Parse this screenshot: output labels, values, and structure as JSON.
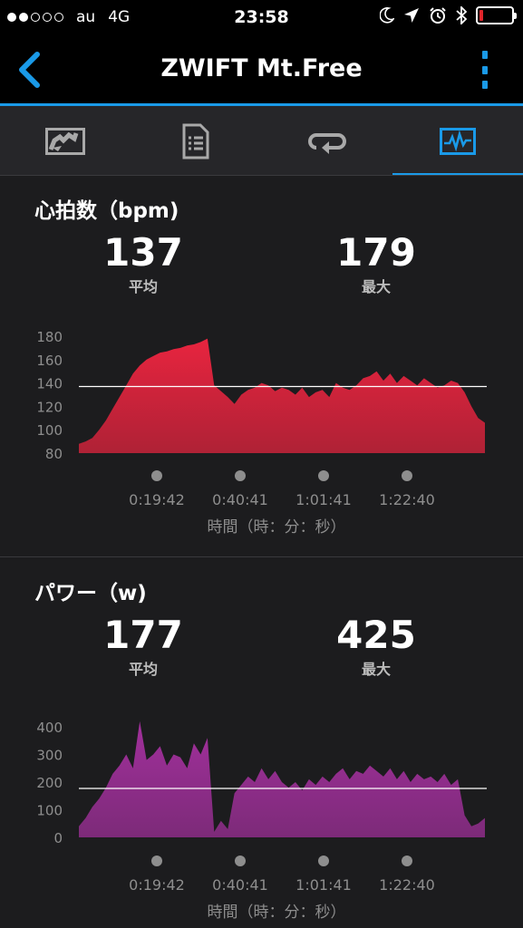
{
  "status_bar": {
    "carrier": "au",
    "network": "4G",
    "time": "23:58",
    "battery_level": 0.1,
    "icons": [
      "moon-icon",
      "location-arrow-icon",
      "alarm-clock-icon",
      "bluetooth-icon",
      "battery-icon"
    ]
  },
  "nav": {
    "title": "ZWIFT Mt.Free",
    "back_icon": "chevron-left-icon",
    "more_icon": "more-vertical-icon",
    "accent_color": "#1a9ae8"
  },
  "tabs": [
    {
      "icon": "map-icon",
      "active": false
    },
    {
      "icon": "list-document-icon",
      "active": false
    },
    {
      "icon": "laps-loop-icon",
      "active": false
    },
    {
      "icon": "chart-pulse-icon",
      "active": true
    }
  ],
  "heart_rate": {
    "title": "心拍数（bpm)",
    "avg_value": "137",
    "avg_label": "平均",
    "max_value": "179",
    "max_label": "最大",
    "fill_color": "#e8243f",
    "chart_data": {
      "type": "area",
      "ylim": [
        80,
        180
      ],
      "yticks": [
        "180",
        "160",
        "140",
        "120",
        "100",
        "80"
      ],
      "xticks": [
        "0:19:42",
        "0:40:41",
        "1:01:41",
        "1:22:40"
      ],
      "xlabel": "時間（時：分：秒）",
      "avg_line": 137,
      "x_range": [
        0,
        6000
      ],
      "x": [
        0,
        100,
        200,
        300,
        400,
        500,
        600,
        700,
        800,
        900,
        1000,
        1100,
        1200,
        1300,
        1400,
        1500,
        1600,
        1700,
        1800,
        1900,
        2000,
        2100,
        2200,
        2300,
        2400,
        2500,
        2600,
        2700,
        2800,
        2900,
        3000,
        3100,
        3200,
        3300,
        3400,
        3500,
        3600,
        3700,
        3800,
        3900,
        4000,
        4100,
        4200,
        4300,
        4400,
        4500,
        4600,
        4700,
        4800,
        4900,
        5000,
        5100,
        5200,
        5300,
        5400,
        5500,
        5600,
        5700,
        5800,
        5900,
        6000
      ],
      "values": [
        88,
        90,
        93,
        100,
        108,
        118,
        128,
        138,
        148,
        155,
        160,
        163,
        166,
        167,
        169,
        170,
        172,
        173,
        175,
        178,
        138,
        133,
        128,
        122,
        130,
        134,
        136,
        140,
        138,
        133,
        136,
        134,
        130,
        136,
        128,
        132,
        134,
        128,
        140,
        136,
        134,
        138,
        144,
        146,
        150,
        142,
        148,
        140,
        146,
        142,
        138,
        144,
        140,
        136,
        138,
        142,
        140,
        132,
        120,
        110,
        106
      ]
    }
  },
  "power": {
    "title": "パワー（w)",
    "avg_value": "177",
    "avg_label": "平均",
    "max_value": "425",
    "max_label": "最大",
    "fill_color": "#a2309c",
    "chart_data": {
      "type": "area",
      "ylim": [
        0,
        400
      ],
      "yticks": [
        "400",
        "300",
        "200",
        "100",
        "0"
      ],
      "xticks": [
        "0:19:42",
        "0:40:41",
        "1:01:41",
        "1:22:40"
      ],
      "xlabel": "時間（時：分：秒）",
      "avg_line": 177,
      "x_range": [
        0,
        6000
      ],
      "x": [
        0,
        100,
        200,
        300,
        400,
        500,
        600,
        700,
        800,
        900,
        1000,
        1100,
        1200,
        1300,
        1400,
        1500,
        1600,
        1700,
        1800,
        1900,
        2000,
        2100,
        2200,
        2300,
        2400,
        2500,
        2600,
        2700,
        2800,
        2900,
        3000,
        3100,
        3200,
        3300,
        3400,
        3500,
        3600,
        3700,
        3800,
        3900,
        4000,
        4100,
        4200,
        4300,
        4400,
        4500,
        4600,
        4700,
        4800,
        4900,
        5000,
        5100,
        5200,
        5300,
        5400,
        5500,
        5600,
        5700,
        5800,
        5900,
        6000
      ],
      "values": [
        40,
        70,
        110,
        140,
        180,
        230,
        260,
        300,
        250,
        420,
        280,
        300,
        330,
        260,
        300,
        290,
        250,
        340,
        300,
        360,
        20,
        60,
        30,
        160,
        190,
        220,
        200,
        250,
        210,
        240,
        200,
        180,
        200,
        170,
        210,
        190,
        220,
        200,
        230,
        250,
        210,
        240,
        230,
        260,
        240,
        220,
        250,
        210,
        240,
        200,
        230,
        210,
        220,
        200,
        230,
        190,
        210,
        80,
        40,
        50,
        70
      ]
    }
  }
}
